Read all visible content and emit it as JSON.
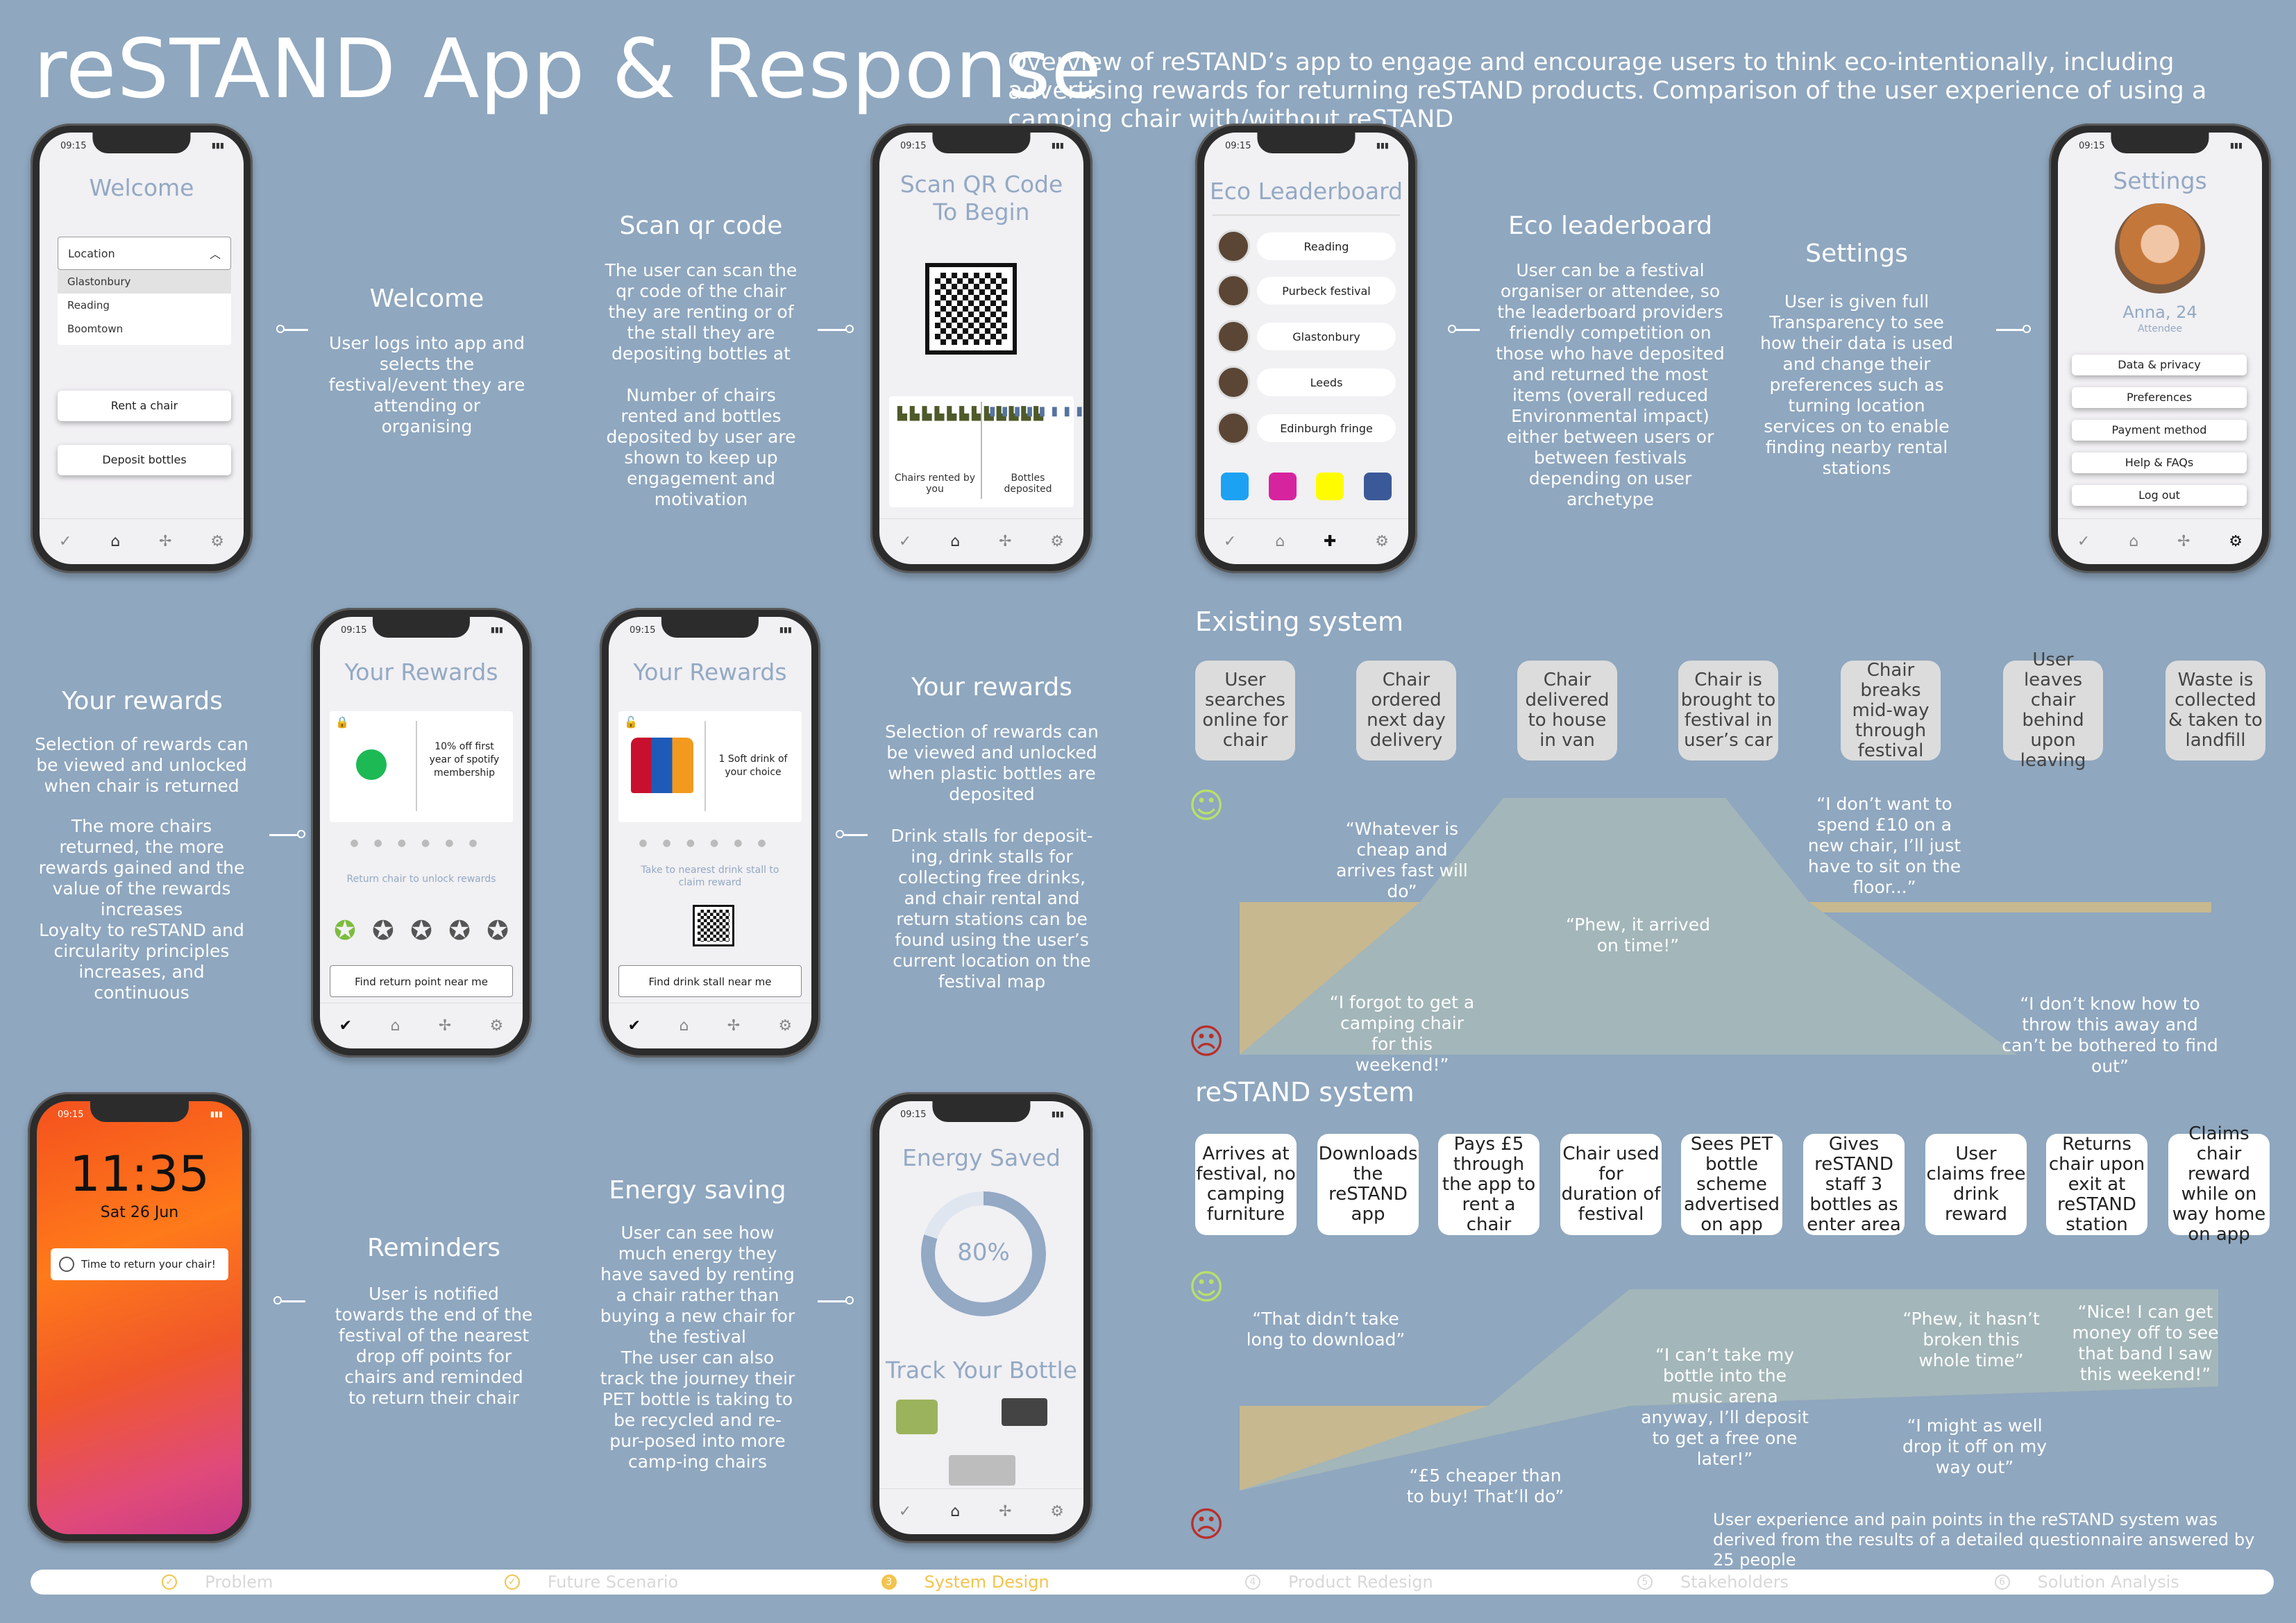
{
  "title": "reSTAND App & Response",
  "subtitle": "Overview of reSTAND’s app to engage and encourage users to think eco-intentionally, including advertising rewards for returning reSTAND products. Comparison of the user experience of using a camping chair with/without reSTAND",
  "time": "09:15",
  "welcome": {
    "screen_title": "Welcome",
    "dropdown_label": "Location",
    "options": [
      "Glastonbury",
      "Reading",
      "Boomtown"
    ],
    "rent_btn": "Rent a chair",
    "deposit_btn": "Deposit bottles",
    "heading": "Welcome",
    "desc": "User logs into app and selects the festival/event they are attending or organising"
  },
  "scan": {
    "screen_title": "Scan QR Code To Begin",
    "chairs_label": "Chairs rented by you",
    "bottles_label": "Bottles deposited",
    "heading": "Scan qr code",
    "desc1": "The user can scan the qr code of the chair they are renting or of the stall they are depositing bottles at",
    "desc2": "Number of chairs rented and bottles deposited by user are shown to keep up engagement and motivation"
  },
  "leader": {
    "screen_title": "Eco Leaderboard",
    "entries": [
      "Reading",
      "Purbeck festival",
      "Glastonbury",
      "Leeds",
      "Edinburgh fringe"
    ],
    "heading": "Eco leaderboard",
    "desc": "User can be a festival organiser or attendee, so the leaderboard providers friendly competition on those who have deposited and returned the most items (overall reduced Environmental impact) either between users or between festivals depending on user archetype"
  },
  "settings": {
    "screen_title": "Settings",
    "name": "Anna, 24",
    "role": "Attendee",
    "items": [
      "Data & privacy",
      "Preferences",
      "Payment method",
      "Help & FAQs",
      "Log out"
    ],
    "heading": "Settings",
    "desc": "User is given full Transparency to see how their data is used and change their preferences such as turning location services on to enable finding nearby rental stations"
  },
  "rewards1": {
    "screen_title": "Your Rewards",
    "offer": "10% off first year of spotify membership",
    "hint": "Return chair to unlock rewards",
    "btn": "Find return point near me",
    "heading": "Your rewards",
    "desc1": "Selection of rewards can be viewed and unlocked when chair is returned",
    "desc2": "The more chairs returned, the more rewards gained and the value of the rewards increases",
    "desc3": "Loyalty to reSTAND and circularity principles increases, and continuous"
  },
  "rewards2": {
    "screen_title": "Your Rewards",
    "offer": "1 Soft drink of your choice",
    "hint": "Take to nearest drink stall to claim reward",
    "btn": "Find drink stall near me",
    "heading": "Your rewards",
    "desc1": "Selection of rewards can be viewed and unlocked when plastic bottles are deposited",
    "desc2": "Drink stalls for deposit-ing, drink stalls for collecting free drinks, and chair rental and return stations can be found using the user’s current location  on the festival map"
  },
  "reminder": {
    "clock": "11:35",
    "date": "Sat 26 Jun",
    "notif": "Time to return your chair!",
    "heading": "Reminders",
    "desc": "User is notified towards the end of the festival of the nearest drop off points for chairs and reminded to return their chair"
  },
  "energy": {
    "screen_title": "Energy Saved",
    "percent_label": "80%",
    "percent": 0.8,
    "track": "Track Your Bottle",
    "heading": "Energy saving",
    "desc1": "User can see how much energy they have saved by renting a chair rather than buying a new chair for the festival",
    "desc2": "The user can also track the journey their PET bottle is taking to be recycled and re-pur-posed into more camp-ing chairs"
  },
  "existing": {
    "heading": "Existing system",
    "steps": [
      "User searches online for chair",
      "Chair ordered next day delivery",
      "Chair delivered to house in van",
      "Chair is brought to festival in user’s car",
      "Chair breaks mid-way through festival",
      "User leaves chair behind upon leaving",
      "Waste is collected & taken to landfill"
    ],
    "quotes": [
      "“Whatever is cheap and arrives fast will do”",
      "“I forgot to get a camping chair for this weekend!”",
      "“Phew, it arrived on time!”",
      "“I don’t want to spend £10 on a new chair, I’ll just have to sit on the floor...”",
      "“I don’t know how to throw this away and can’t be bothered to find out”"
    ]
  },
  "restand": {
    "heading": "reSTAND system",
    "steps": [
      "Arrives at festival, no camping furniture",
      "Downloads the reSTAND app",
      "Pays £5 through the app to rent a chair",
      "Chair used for duration of festival",
      "Sees PET bottle scheme advertised on app",
      "Gives reSTAND staff 3 bottles as enter area",
      "User claims free drink reward",
      "Returns chair upon exit at reSTAND station",
      "Claims chair reward while on way home on app"
    ],
    "quotes": [
      "“That didn’t take long to download”",
      "“£5 cheaper than to buy! That’ll do”",
      "“I can’t take my bottle into the music arena anyway, I’ll deposit to get a free one later!”",
      "“Phew, it hasn’t broken this whole time”",
      "“I might as well drop it off on my way out”",
      "“Nice! I can get money off to see that band I saw this weekend!”"
    ],
    "note": "User experience and pain points in the reSTAND system was  derived from the results of a detailed questionnaire answered by 25 people"
  },
  "nav": [
    {
      "n": "1",
      "label": "Problem"
    },
    {
      "n": "2",
      "label": "Future Scenario"
    },
    {
      "n": "3",
      "label": "System Design"
    },
    {
      "n": "4",
      "label": "Product Redesign"
    },
    {
      "n": "5",
      "label": "Stakeholders"
    },
    {
      "n": "6",
      "label": "Solution Analysis"
    }
  ],
  "colors": {
    "bg": "#8fa7bf",
    "accent": "#f2c44e",
    "tan": "#c7b890",
    "teal": "#a3b6b9",
    "happy": "#b8e06a",
    "sad": "#b8302a"
  }
}
